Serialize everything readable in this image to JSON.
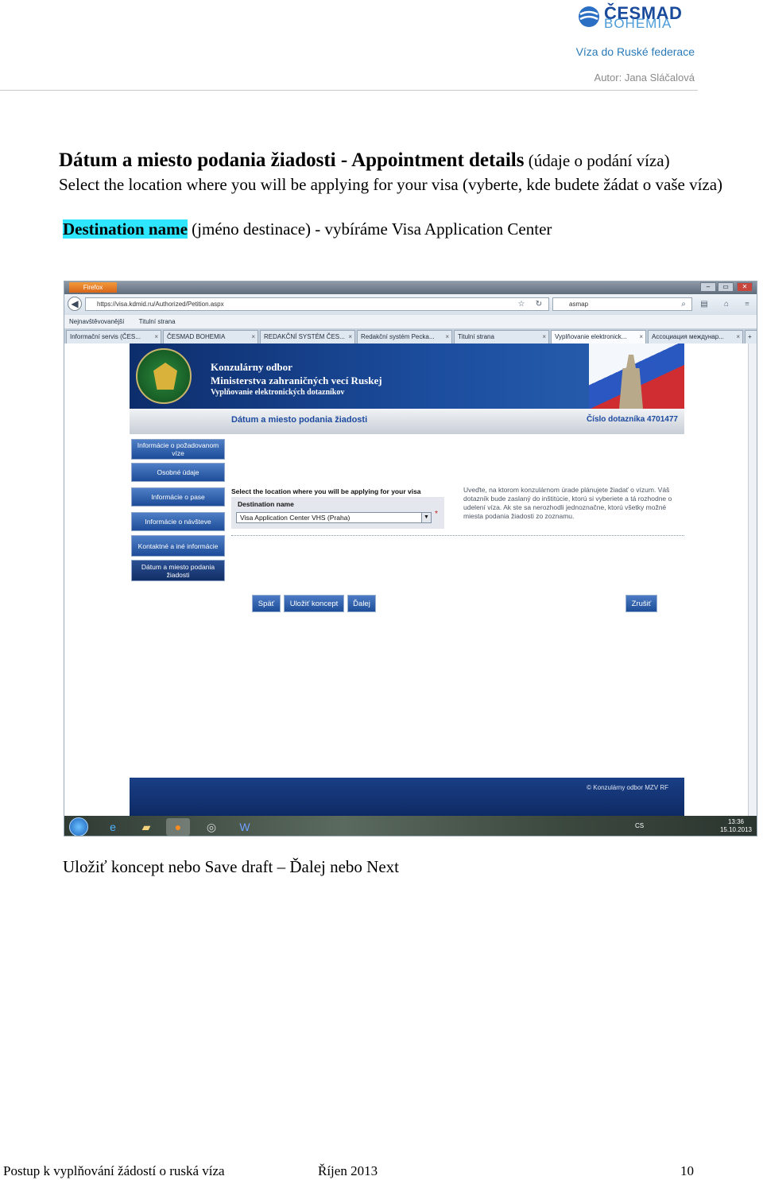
{
  "header": {
    "logo_line1": "ČESMAD",
    "logo_line2": "BOHEMIA",
    "doc_title": "Víza do Ruské federace",
    "author": "Autor: Jana Sláčalová"
  },
  "intro": {
    "heading_bold": "Dátum a miesto podania žiadosti - Appointment details",
    "heading_sub": " (údaje o podání víza)",
    "line2": "Select the location where you will be applying for your visa (vyberte, kde budete žádat o vaše víza)",
    "line3_highlight": "Destination name",
    "line3_rest": " (jméno destinace)  - vybíráme Visa Application Center"
  },
  "browser": {
    "firefox_button": "Firefox",
    "url": "https://visa.kdmid.ru/Authorized/Petition.aspx",
    "search_value": "asmap",
    "bookmarks": [
      "Nejnavštěvovanější",
      "Titulní strana"
    ],
    "tabs": [
      "Informační servis (ČES...",
      "ČESMAD BOHEMIA",
      "REDAKČNÍ SYSTÉM ČES...",
      "Redakční systém Pecka...",
      "Titulní strana",
      "Vyplňovanie elektronick...",
      "Ассоциация междунар..."
    ],
    "new_tab": "+"
  },
  "site": {
    "banner_line1": "Konzulárny odbor",
    "banner_line2": "Ministerstva zahraničných vecí Ruskej",
    "banner_line3": "Vyplňovanie elektronických dotazníkov",
    "section_title": "Dátum a miesto podania žiadosti",
    "questionnaire_no": "Číslo dotazníka 4701477",
    "menu": [
      "Informácie o požadovanom víze",
      "Osobné údaje",
      "Informácie o pase",
      "Informácie o návšteve",
      "Kontaktné a iné informácie",
      "Dátum a miesto podania žiadosti"
    ],
    "form_instruction": "Select the location where you will be applying for your visa",
    "field_label": "Destination name",
    "field_value": "Visa Application Center VHS (Praha)",
    "required_mark": "*",
    "help_text": "Uveďte, na ktorom konzulárnom úrade plánujete žiadať o vízum. Váš dotazník bude zaslaný do inštitúcie, ktorú si vyberiete a tá rozhodne o udelení víza. Ak ste sa nerozhodli jednoznačne, ktorú všetky možné miesta podania žiadosti zo zoznamu.",
    "buttons": {
      "back": "Späť",
      "save_draft": "Uložiť koncept",
      "next": "Ďalej",
      "cancel": "Zrušiť"
    },
    "footer": "© Konzulárny odbor MZV RF"
  },
  "taskbar": {
    "language": "CS",
    "time": "13:36",
    "date": "15.10.2013"
  },
  "caption": "Uložiť koncept nebo Save draft – Ďalej nebo Next",
  "footer": {
    "left": "Postup k vyplňování žádostí o ruská víza",
    "center": "Říjen 2013",
    "page": "10"
  }
}
